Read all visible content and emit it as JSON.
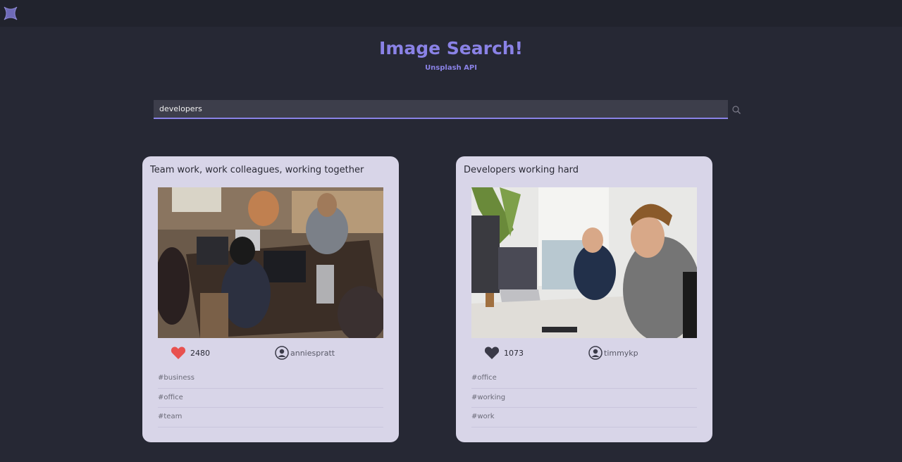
{
  "header": {
    "logo_icon": "x-star-logo-icon",
    "title": "Image Search!",
    "subtitle": "Unsplash API"
  },
  "search": {
    "value": "developers",
    "button_icon": "search-icon"
  },
  "colors": {
    "accent": "#8a82e6",
    "background": "#262834",
    "card": "#d8d5e8",
    "heart_liked": "#e8514f",
    "heart_default": "#3a3a48"
  },
  "cards": [
    {
      "title": "Team work, work colleagues, working together",
      "likes": "2480",
      "liked": true,
      "user": "anniespratt",
      "tags": [
        "#business",
        "#office",
        "#team"
      ]
    },
    {
      "title": "Developers working hard",
      "likes": "1073",
      "liked": false,
      "user": "timmykp",
      "tags": [
        "#office",
        "#working",
        "#work"
      ]
    }
  ]
}
